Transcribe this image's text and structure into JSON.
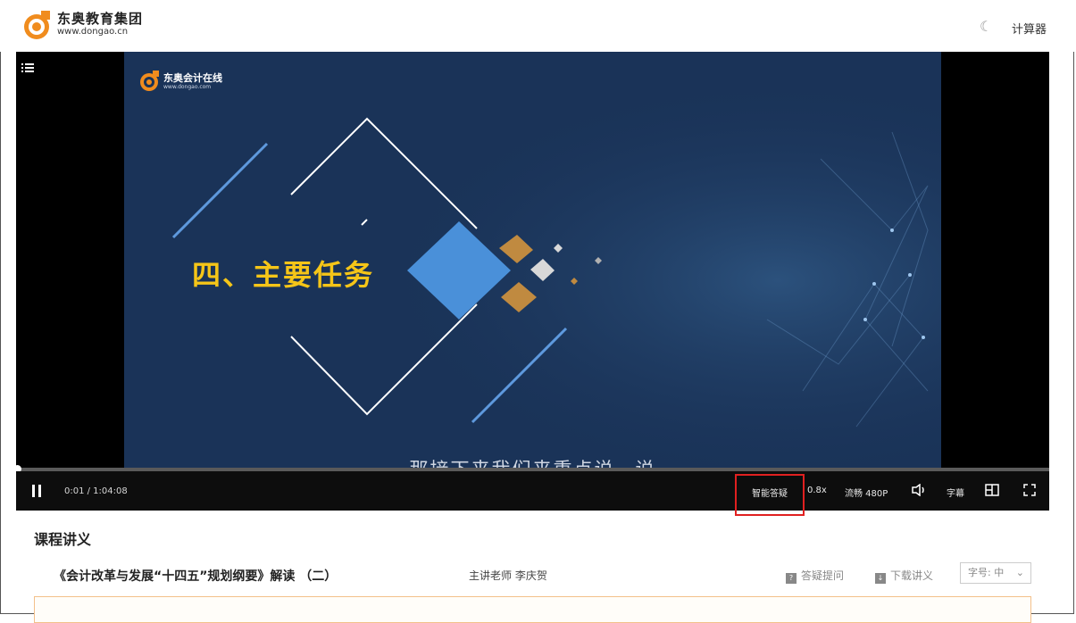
{
  "header": {
    "brand_cn": "东奥教育集团",
    "brand_en": "www.dongao.cn",
    "moon_icon": "moon-icon",
    "calculator_label": "计算器"
  },
  "slide": {
    "logo_cn": "东奥会计在线",
    "logo_en": "www.dongao.com",
    "title": "四、主要任务"
  },
  "player": {
    "subtitle": "那接下来我们来重点说一说",
    "time": "0:01 / 1:04:08",
    "progress_fraction": 0.0003,
    "ask_label": "智能答疑",
    "speed_label": "0.8x",
    "quality_label": "流畅 480P",
    "caption_label": "字幕",
    "icons": [
      "pause-icon",
      "volume-icon",
      "pip-icon",
      "fullscreen-icon",
      "list-icon"
    ]
  },
  "notes": {
    "section_title": "课程讲义",
    "course_title": "《会计改革与发展“十四五”规划纲要》解读 （二）",
    "teacher": "主讲老师 李庆贺",
    "ask_question_label": "答疑提问",
    "download_label": "下载讲义",
    "font_size_label": "字号: 中"
  },
  "colors": {
    "slide_bg": "#1a3358",
    "title_yellow": "#f5c518",
    "highlight_red": "#e02020",
    "brand_orange": "#f08c1e"
  }
}
